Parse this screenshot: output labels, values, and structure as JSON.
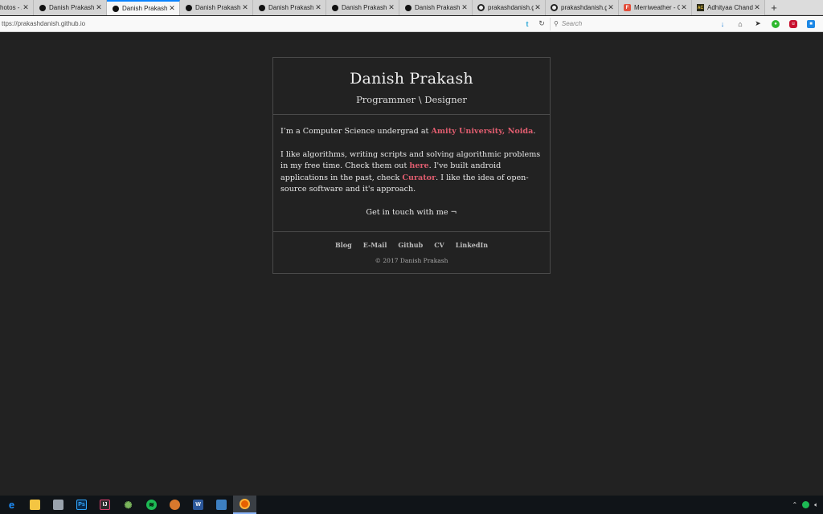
{
  "browser": {
    "tabs": [
      {
        "title": "hotos - /",
        "favicon": "none",
        "active": false
      },
      {
        "title": "Danish Prakash",
        "favicon": "black-circle",
        "active": false
      },
      {
        "title": "Danish Prakash",
        "favicon": "black-circle",
        "active": true
      },
      {
        "title": "Danish Prakash",
        "favicon": "black-circle",
        "active": false
      },
      {
        "title": "Danish Prakash",
        "favicon": "black-circle",
        "active": false
      },
      {
        "title": "Danish Prakash",
        "favicon": "black-circle",
        "active": false
      },
      {
        "title": "Danish Prakash",
        "favicon": "black-circle",
        "active": false
      },
      {
        "title": "prakashdanish.gi",
        "favicon": "github",
        "active": false
      },
      {
        "title": "prakashdanish.gi",
        "favicon": "github",
        "active": false
      },
      {
        "title": "Merriweather - Gc",
        "favicon": "google-fonts",
        "active": false
      },
      {
        "title": "Adhityaa Chandr.",
        "favicon": "ac-logo",
        "active": false
      }
    ],
    "new_tab_glyph": "+",
    "url": "ttps://prakashdanish.github.io",
    "search_placeholder": "Search"
  },
  "page": {
    "title": "Danish Prakash",
    "subtitle": "Programmer \\ Designer",
    "intro": {
      "before": "I’m a Computer Science undergrad at ",
      "link": "Amity University, Noida",
      "after": "."
    },
    "para2": {
      "t1": "I like algorithms, writing scripts and solving algorithmic problems in my free time. Check them out ",
      "link1": "here",
      "t2": ". I've built android applications in the past, check ",
      "link2": "Curator",
      "t3": ". I like the idea of open-source software and it's approach."
    },
    "contact": "Get in touch with me ¬",
    "footer_links": [
      "Blog",
      "E-Mail",
      "Github",
      "CV",
      "LinkedIn"
    ],
    "copyright": "© 2017 Danish Prakash"
  },
  "colors": {
    "background": "#222222",
    "border": "#4a4a4a",
    "link": "#e05d6f",
    "text": "#e6e6e6"
  }
}
